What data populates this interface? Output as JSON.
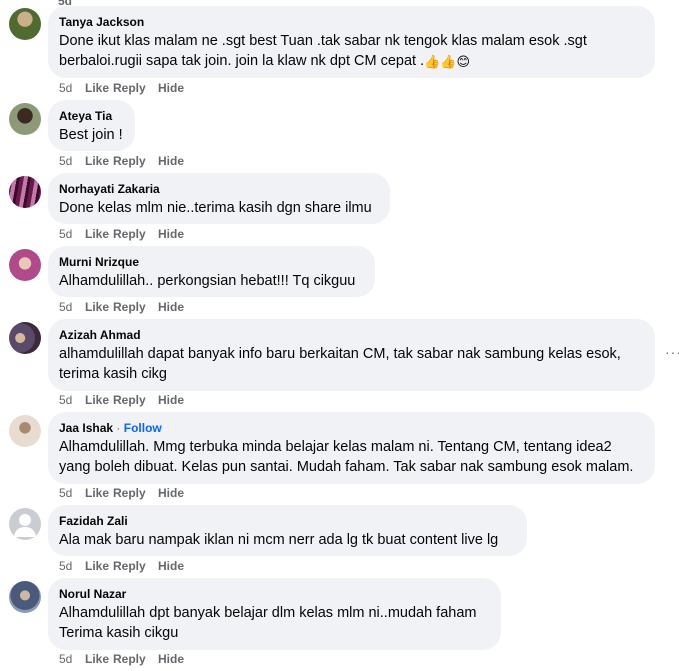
{
  "top_actions": {
    "time": "5d",
    "like": "Like",
    "reply": "Reply",
    "hide": "Hide"
  },
  "comments": [
    {
      "author": "Tanya Jackson",
      "lines": [
        "Done ikut klas malam ne .sgt best Tuan .tak sabar nk tengok klas malam esok .sgt",
        "berbaloi.rugii sapa tak join. join la klaw nk dpt CM cepat ."
      ],
      "emojis": [
        "👍",
        "👍",
        "😊"
      ],
      "time": "5d",
      "like": "Like",
      "reply": "Reply",
      "hide": "Hide",
      "avatar_color": "#5a7a3a"
    },
    {
      "author": "Ateya Tia",
      "lines": [
        "Best join !"
      ],
      "time": "5d",
      "like": "Like",
      "reply": "Reply",
      "hide": "Hide",
      "avatar_color": "#6b5a4a"
    },
    {
      "author": "Norhayati Zakaria",
      "lines": [
        "Done kelas mlm nie..terima kasih dgn share ilmu"
      ],
      "time": "5d",
      "like": "Like",
      "reply": "Reply",
      "hide": "Hide",
      "avatar_color": "#8a3a6a"
    },
    {
      "author": "Murni Nrizque",
      "lines": [
        "Alhamdulillah.. perkongsian hebat!!! Tq cikguu"
      ],
      "time": "5d",
      "like": "Like",
      "reply": "Reply",
      "hide": "Hide",
      "avatar_color": "#b04a8a"
    },
    {
      "author": "Azizah Ahmad",
      "lines": [
        "alhamdulillah dapat banyak info baru berkaitan CM, tak sabar nak sambung kelas esok,",
        "terima kasih cikg"
      ],
      "time": "5d",
      "like": "Like",
      "reply": "Reply",
      "hide": "Hide",
      "more": "···",
      "avatar_color": "#5a4a6a"
    },
    {
      "author": "Jaa Ishak",
      "separator": "·",
      "follow": "Follow",
      "lines": [
        "Alhamdulillah. Mmg terbuka minda belajar kelas malam ni. Tentang CM, tentang idea2",
        "yang boleh dibuat. Kelas pun santai. Mudah faham. Tak sabar nak sambung esok malam."
      ],
      "time": "5d",
      "like": "Like",
      "reply": "Reply",
      "hide": "Hide",
      "avatar_color": "#c8b8a8"
    },
    {
      "author": "Fazidah Zali",
      "lines": [
        "Ala mak baru nampak iklan ni mcm nerr ada lg tk buat content live lg"
      ],
      "time": "5d",
      "like": "Like",
      "reply": "Reply",
      "hide": "Hide",
      "avatar_color": "#c9ccd1"
    },
    {
      "author": "Norul Nazar",
      "lines": [
        "Alhamdulillah dpt banyak belajar dlm kelas mlm ni..mudah faham",
        "Terima kasih cikgu"
      ],
      "time": "5d",
      "like": "Like",
      "reply": "Reply",
      "hide": "Hide",
      "avatar_color": "#4a5a7a"
    }
  ]
}
